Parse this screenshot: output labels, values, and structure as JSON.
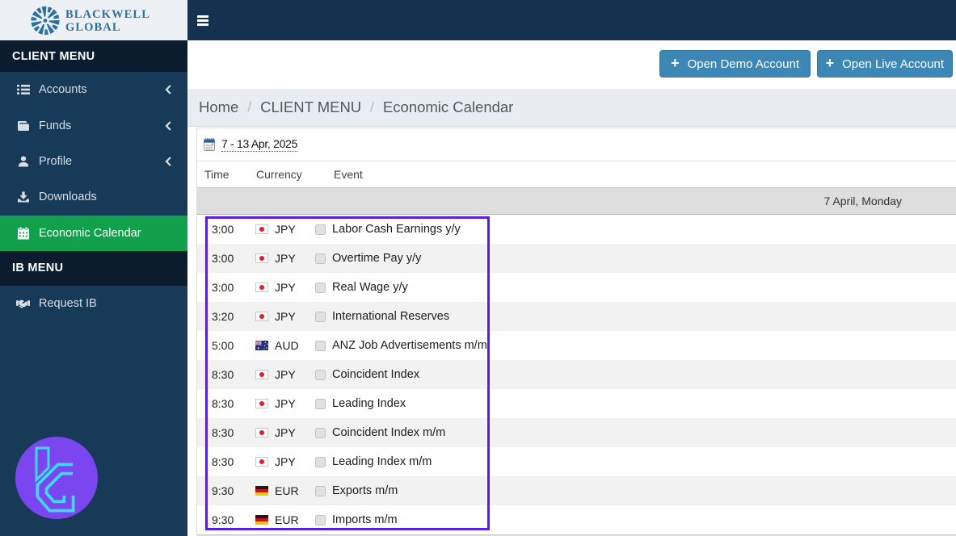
{
  "logo": {
    "line1": "BLACKWELL",
    "line2": "GLOBAL",
    "icon": "sunburst-icon",
    "color": "#2d6f9e"
  },
  "sidebar": {
    "client_menu_label": "CLIENT MENU",
    "ib_menu_label": "IB MENU",
    "client_items": [
      {
        "label": "Accounts",
        "icon": "list-icon",
        "chevron": true,
        "active": false
      },
      {
        "label": "Funds",
        "icon": "wallet-icon",
        "chevron": true,
        "active": false
      },
      {
        "label": "Profile",
        "icon": "user-icon",
        "chevron": true,
        "active": false
      },
      {
        "label": "Downloads",
        "icon": "download-icon",
        "chevron": false,
        "active": false
      },
      {
        "label": "Economic Calendar",
        "icon": "calendar-icon",
        "chevron": false,
        "active": true
      }
    ],
    "ib_items": [
      {
        "label": "Request IB",
        "icon": "handshake-icon",
        "chevron": false,
        "active": false
      }
    ],
    "active_color": "#18a24a"
  },
  "topbar": {
    "menu_icon": "hamburger-icon",
    "color": "#0d2337"
  },
  "actions": {
    "demo_label": "Open Demo Account",
    "live_label": "Open Live Account",
    "button_color": "#3b87b8"
  },
  "breadcrumb": {
    "items": [
      "Home",
      "CLIENT MENU",
      "Economic Calendar"
    ],
    "separator": "/"
  },
  "calendar": {
    "date_range": "7 - 13 Apr, 2025",
    "columns": [
      "Time",
      "Currency",
      "Event"
    ],
    "day_label": "7 April, Monday",
    "rows": [
      {
        "time": "3:00",
        "currency": "JPY",
        "flag": "japan-flag",
        "event": "Labor Cash Earnings y/y"
      },
      {
        "time": "3:00",
        "currency": "JPY",
        "flag": "japan-flag",
        "event": "Overtime Pay y/y"
      },
      {
        "time": "3:00",
        "currency": "JPY",
        "flag": "japan-flag",
        "event": "Real Wage y/y"
      },
      {
        "time": "3:20",
        "currency": "JPY",
        "flag": "japan-flag",
        "event": "International Reserves"
      },
      {
        "time": "5:00",
        "currency": "AUD",
        "flag": "australia-flag",
        "event": "ANZ Job Advertisements m/m"
      },
      {
        "time": "8:30",
        "currency": "JPY",
        "flag": "japan-flag",
        "event": "Coincident Index"
      },
      {
        "time": "8:30",
        "currency": "JPY",
        "flag": "japan-flag",
        "event": "Leading Index"
      },
      {
        "time": "8:30",
        "currency": "JPY",
        "flag": "japan-flag",
        "event": "Coincident Index m/m"
      },
      {
        "time": "8:30",
        "currency": "JPY",
        "flag": "japan-flag",
        "event": "Leading Index m/m"
      },
      {
        "time": "9:30",
        "currency": "EUR",
        "flag": "germany-flag",
        "event": "Exports m/m"
      },
      {
        "time": "9:30",
        "currency": "EUR",
        "flag": "germany-flag",
        "event": "Imports m/m"
      }
    ]
  },
  "annotation": {
    "color": "#5f25dd",
    "shape": "rectangle"
  },
  "watermark": {
    "icon": "tc-monogram-icon",
    "circle_color": "#7b46f0",
    "glyph_color": "#3fd9fc"
  }
}
